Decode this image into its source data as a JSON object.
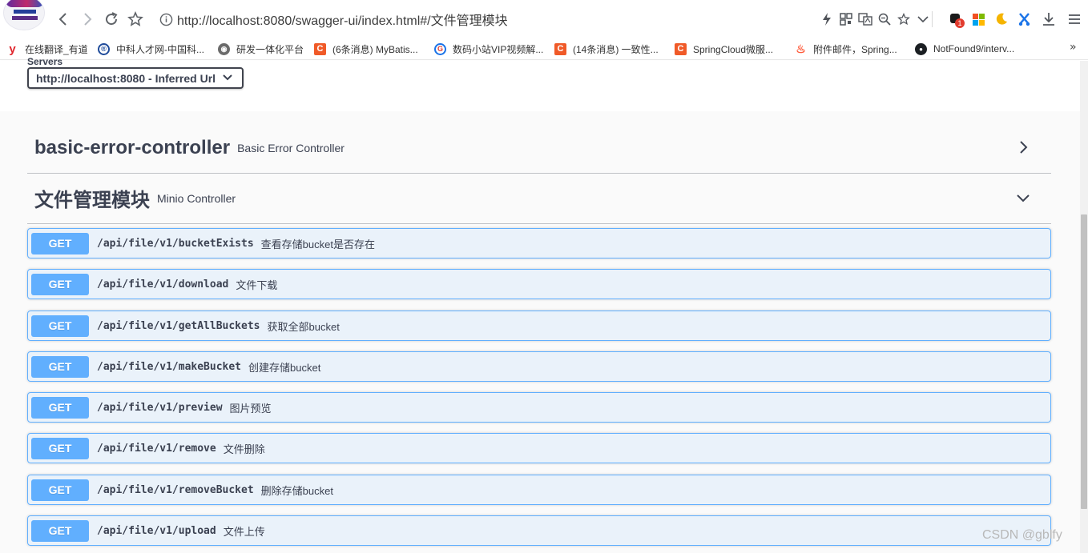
{
  "browser": {
    "url": "http://localhost:8080/swagger-ui/index.html#/文件管理模块",
    "notification_badge": "1",
    "colors": {
      "accent": "#1a73e8"
    }
  },
  "bookmarks": [
    {
      "label": "在线翻译_有道",
      "icon": "youdao-icon",
      "color": "#e0262d",
      "glyph": "y"
    },
    {
      "label": "中科人才网-中国科...",
      "icon": "zkrc-icon",
      "color": "#1f4b9a",
      "glyph": "®"
    },
    {
      "label": "研发一体化平台",
      "icon": "globe-icon",
      "color": "#6b6b6b",
      "glyph": "◉"
    },
    {
      "label": "(6条消息) MyBatis...",
      "icon": "csdn-icon",
      "color": "#f05a28",
      "glyph": "C"
    },
    {
      "label": "数码小站VIP视频解...",
      "icon": "swirl-icon",
      "color": "#1a73e8",
      "glyph": "G"
    },
    {
      "label": "(14条消息) 一致性...",
      "icon": "csdn-icon",
      "color": "#f05a28",
      "glyph": "C"
    },
    {
      "label": "SpringCloud微服...",
      "icon": "csdn-icon",
      "color": "#f05a28",
      "glyph": "C"
    },
    {
      "label": "附件邮件，Spring...",
      "icon": "flame-icon",
      "color": "#ff5b3a",
      "glyph": "♨"
    },
    {
      "label": "NotFound9/interv...",
      "icon": "github-icon",
      "color": "#1b1f23",
      "glyph": "●"
    }
  ],
  "servers": {
    "label": "Servers",
    "selected": "http://localhost:8080 - Inferred Url"
  },
  "tags": [
    {
      "name": "basic-error-controller",
      "description": "Basic Error Controller",
      "expanded": false
    },
    {
      "name": "文件管理模块",
      "description": "Minio Controller",
      "expanded": true
    }
  ],
  "operations": [
    {
      "method": "GET",
      "path": "/api/file/v1/bucketExists",
      "summary": "查看存储bucket是否存在"
    },
    {
      "method": "GET",
      "path": "/api/file/v1/download",
      "summary": "文件下载"
    },
    {
      "method": "GET",
      "path": "/api/file/v1/getAllBuckets",
      "summary": "获取全部bucket"
    },
    {
      "method": "GET",
      "path": "/api/file/v1/makeBucket",
      "summary": "创建存储bucket"
    },
    {
      "method": "GET",
      "path": "/api/file/v1/preview",
      "summary": "图片预览"
    },
    {
      "method": "GET",
      "path": "/api/file/v1/remove",
      "summary": "文件删除"
    },
    {
      "method": "GET",
      "path": "/api/file/v1/removeBucket",
      "summary": "删除存储bucket"
    },
    {
      "method": "GET",
      "path": "/api/file/v1/upload",
      "summary": "文件上传"
    }
  ],
  "colors": {
    "get": "#61affe",
    "text": "#3b4151"
  },
  "watermark": "CSDN @gblfy"
}
